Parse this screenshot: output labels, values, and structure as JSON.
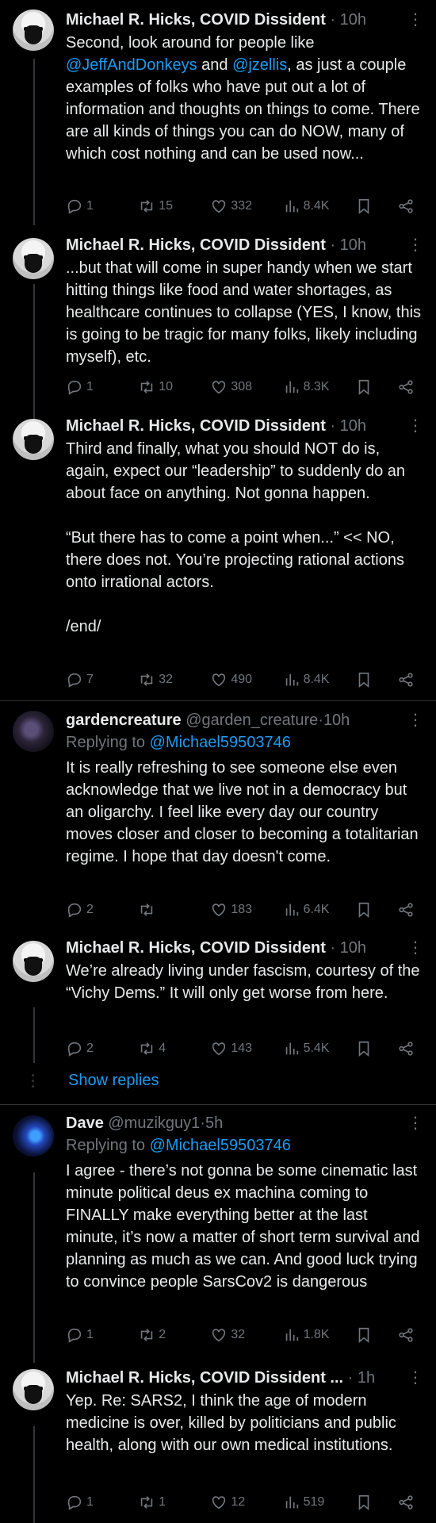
{
  "tweets": [
    {
      "name": "Michael R. Hicks, COVID Dissident",
      "handle": "",
      "dot": "·",
      "time": "10h",
      "body_parts": [
        "Second, look around for people like ",
        "@JeffAndDonkeys",
        " and ",
        "@jzellis",
        ", as just a couple examples of folks who have put out a lot of information and thoughts on things to come. There are all kinds of things you can do NOW, many of which cost nothing and can be used now..."
      ],
      "replies": "1",
      "reposts": "15",
      "likes": "332",
      "views": "8.4K"
    },
    {
      "name": "Michael R. Hicks, COVID Dissident",
      "dot": "·",
      "time": "10h",
      "body": "...but that will come in super handy when we start hitting things like food and water shortages, as healthcare continues to collapse (YES, I know, this is going to be tragic for many folks, likely including myself), etc.",
      "replies": "1",
      "reposts": "10",
      "likes": "308",
      "views": "8.3K"
    },
    {
      "name": "Michael R. Hicks, COVID Dissident",
      "dot": "·",
      "time": "10h",
      "body_p1": "Third and finally, what you should NOT do is, again, expect our “leadership” to suddenly do an about face on anything. Not gonna happen.",
      "body_p2": "“But there has to come a point when...” << NO, there does not. You’re projecting rational actions onto irrational actors.",
      "body_p3": "/end/",
      "replies": "7",
      "reposts": "32",
      "likes": "490",
      "views": "8.4K"
    },
    {
      "name": "gardencreature",
      "handle": "@garden_creature",
      "dot": "·",
      "time": "10h",
      "replying_label": "Replying to",
      "replying_to": "@Michael59503746",
      "body": "It is really refreshing to see someone else even acknowledge that we live not in a democracy but an oligarchy. I feel like every day our country moves closer and closer to becoming a totalitarian regime. I hope that day doesn't come.",
      "replies": "2",
      "reposts": "",
      "likes": "183",
      "views": "6.4K"
    },
    {
      "name": "Michael R. Hicks, COVID Dissident",
      "dot": "·",
      "time": "10h",
      "body": "We’re already living under fascism, courtesy of the “Vichy Dems.” It will only get worse from here.",
      "replies": "2",
      "reposts": "4",
      "likes": "143",
      "views": "5.4K"
    },
    {
      "name": "Dave",
      "handle": "@muzikguy1",
      "dot": "·",
      "time": "5h",
      "replying_label": "Replying to",
      "replying_to": "@Michael59503746",
      "body": "I agree - there’s not gonna be some cinematic last minute political deus ex machina coming to FINALLY make everything better at the last minute, it’s now a matter of short term survival and planning as much as we can. And good luck trying to convince people SarsCov2 is dangerous",
      "replies": "1",
      "reposts": "2",
      "likes": "32",
      "views": "1.8K"
    },
    {
      "name": "Michael R. Hicks, COVID Dissident ...",
      "dot": "·",
      "time": "1h",
      "body": "Yep. Re: SARS2, I think the age of modern medicine is over, killed by politicians and public health, along with our own medical institutions.",
      "replies": "1",
      "reposts": "1",
      "likes": "12",
      "views": "519"
    }
  ],
  "show_replies": "Show replies",
  "more_glyph": "⋮",
  "icons": [
    "reply-icon",
    "repost-icon",
    "like-icon",
    "views-icon",
    "bookmark-icon",
    "share-icon"
  ]
}
